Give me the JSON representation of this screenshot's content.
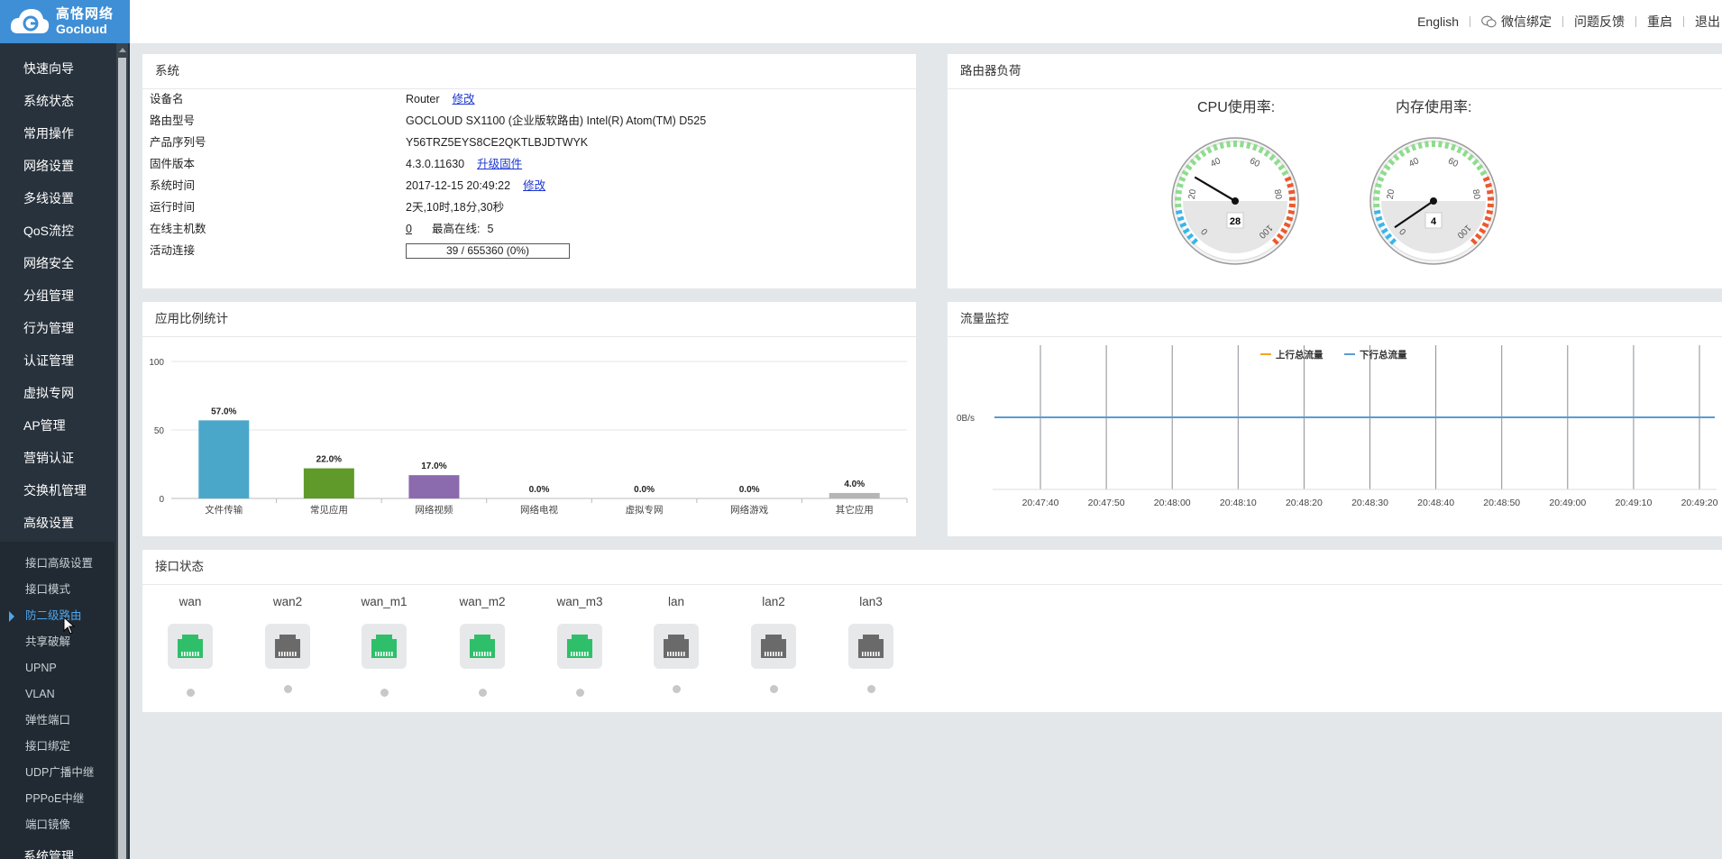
{
  "brand": {
    "line1": "高恪网络",
    "line2": "Gocloud"
  },
  "sidebar": {
    "items": [
      {
        "label": "快速向导"
      },
      {
        "label": "系统状态"
      },
      {
        "label": "常用操作"
      },
      {
        "label": "网络设置"
      },
      {
        "label": "多线设置"
      },
      {
        "label": "QoS流控"
      },
      {
        "label": "网络安全"
      },
      {
        "label": "分组管理"
      },
      {
        "label": "行为管理"
      },
      {
        "label": "认证管理"
      },
      {
        "label": "虚拟专网"
      },
      {
        "label": "AP管理"
      },
      {
        "label": "营销认证"
      },
      {
        "label": "交换机管理"
      },
      {
        "label": "高级设置"
      }
    ],
    "sub_items": [
      {
        "label": "接口高级设置"
      },
      {
        "label": "接口模式"
      },
      {
        "label": "防二级路由"
      },
      {
        "label": "共享破解"
      },
      {
        "label": "UPNP"
      },
      {
        "label": "VLAN"
      },
      {
        "label": "弹性端口"
      },
      {
        "label": "接口绑定"
      },
      {
        "label": "UDP广播中继"
      },
      {
        "label": "PPPoE中继"
      },
      {
        "label": "端口镜像"
      }
    ],
    "active_sub": "防二级路由",
    "last_item": "系统管理"
  },
  "topnav": {
    "english": "English",
    "wechat": "微信绑定",
    "feedback": "问题反馈",
    "reboot": "重启",
    "logout": "退出"
  },
  "system": {
    "title": "系统",
    "rows": {
      "device_name_label": "设备名",
      "device_name": "Router",
      "edit1": "修改",
      "model_label": "路由型号",
      "model": "GOCLOUD SX1100 (企业版软路由) Intel(R) Atom(TM) D525",
      "serial_label": "产品序列号",
      "serial": "Y56TRZ5EYS8CE2QKTLBJDTWYK",
      "fw_label": "固件版本",
      "fw": "4.3.0.11630",
      "upgrade": "升级固件",
      "time_label": "系统时间",
      "time": "2017-12-15 20:49:22",
      "edit2": "修改",
      "uptime_label": "运行时间",
      "uptime": "2天,10时,18分,30秒",
      "hosts_label": "在线主机数",
      "hosts": "0",
      "max_online_label": "最高在线:",
      "max_online": "5",
      "conn_label": "活动连接",
      "conn": "39 / 655360 (0%)"
    }
  },
  "load": {
    "title": "路由器负荷",
    "cpu_label": "CPU使用率:",
    "cpu_value": 28,
    "mem_label": "内存使用率:",
    "mem_value": 4,
    "gauge_ticks": [
      "0",
      "20",
      "40",
      "60",
      "80",
      "100"
    ]
  },
  "colors": {
    "accent": "#3f8fd7",
    "bar1": "#4aa7c9",
    "bar2": "#5f9a2a",
    "bar3": "#8b6aae",
    "bar7": "#b5b5b5",
    "port_up": "#2fbf6a",
    "port_down": "#6a6a6a",
    "up_line": "#f5a623",
    "down_line": "#5b9bd5"
  },
  "app_stats": {
    "title": "应用比例统计",
    "chart_data": {
      "type": "bar",
      "categories": [
        "文件传输",
        "常见应用",
        "网络视频",
        "网络电视",
        "虚拟专网",
        "网络游戏",
        "其它应用"
      ],
      "values": [
        57.0,
        22.0,
        17.0,
        0.0,
        0.0,
        0.0,
        4.0
      ],
      "value_labels": [
        "57.0%",
        "22.0%",
        "17.0%",
        "0.0%",
        "0.0%",
        "0.0%",
        "4.0%"
      ],
      "yticks": [
        "0",
        "50",
        "100"
      ],
      "ylim": [
        0,
        100
      ]
    }
  },
  "traffic": {
    "title": "流量监控",
    "chart_data": {
      "type": "line",
      "legend": [
        "上行总流量",
        "下行总流量"
      ],
      "ylabel_tick": "0B/s",
      "x": [
        "20:47:40",
        "20:47:50",
        "20:48:00",
        "20:48:10",
        "20:48:20",
        "20:48:30",
        "20:48:40",
        "20:48:50",
        "20:49:00",
        "20:49:10",
        "20:49:20"
      ],
      "series": [
        {
          "name": "上行总流量",
          "values": [
            0,
            0,
            0,
            0,
            0,
            0,
            0,
            0,
            0,
            0,
            0
          ]
        },
        {
          "name": "下行总流量",
          "values": [
            0,
            0,
            0,
            0,
            0,
            0,
            0,
            0,
            0,
            0,
            0
          ]
        }
      ]
    }
  },
  "interfaces": {
    "title": "接口状态",
    "items": [
      {
        "name": "wan",
        "up": true
      },
      {
        "name": "wan2",
        "up": false
      },
      {
        "name": "wan_m1",
        "up": true
      },
      {
        "name": "wan_m2",
        "up": true
      },
      {
        "name": "wan_m3",
        "up": true
      },
      {
        "name": "lan",
        "up": false
      },
      {
        "name": "lan2",
        "up": false
      },
      {
        "name": "lan3",
        "up": false
      }
    ]
  }
}
